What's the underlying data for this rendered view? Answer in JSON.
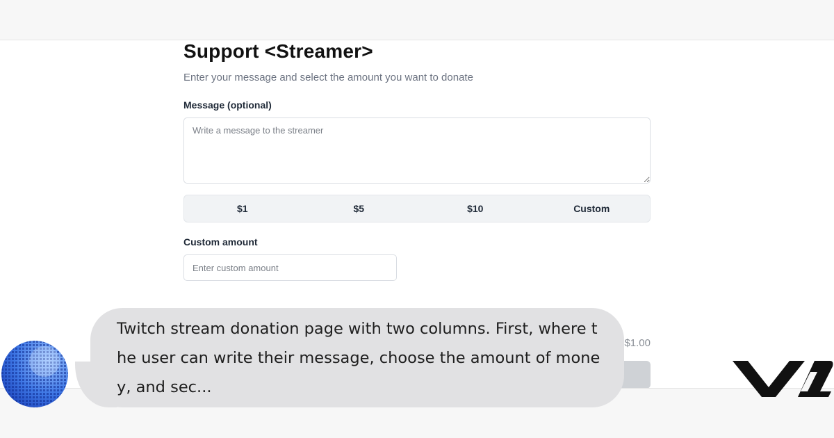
{
  "page": {
    "title": "Support <Streamer>",
    "subtitle": "Enter your message and select the amount you want to donate",
    "message": {
      "label": "Message (optional)",
      "placeholder": "Write a message to the streamer",
      "value": ""
    },
    "amounts": [
      "$1",
      "$5",
      "$10",
      "Custom"
    ],
    "custom_amount": {
      "label": "Custom amount",
      "placeholder": "Enter custom amount",
      "value": ""
    },
    "total": "$1.00"
  },
  "caption": {
    "text": "Twitch stream donation page with two columns. First, where the user can write their message, choose the amount of money, and sec..."
  },
  "colors": {
    "background": "#f7f7f7",
    "bubble": "#e1e1e3",
    "avatar_blue": "#1f4fd1",
    "logo": "#111111"
  },
  "icons": {
    "avatar": "pixel-globe-avatar",
    "logo": "brand-logo-v12"
  }
}
